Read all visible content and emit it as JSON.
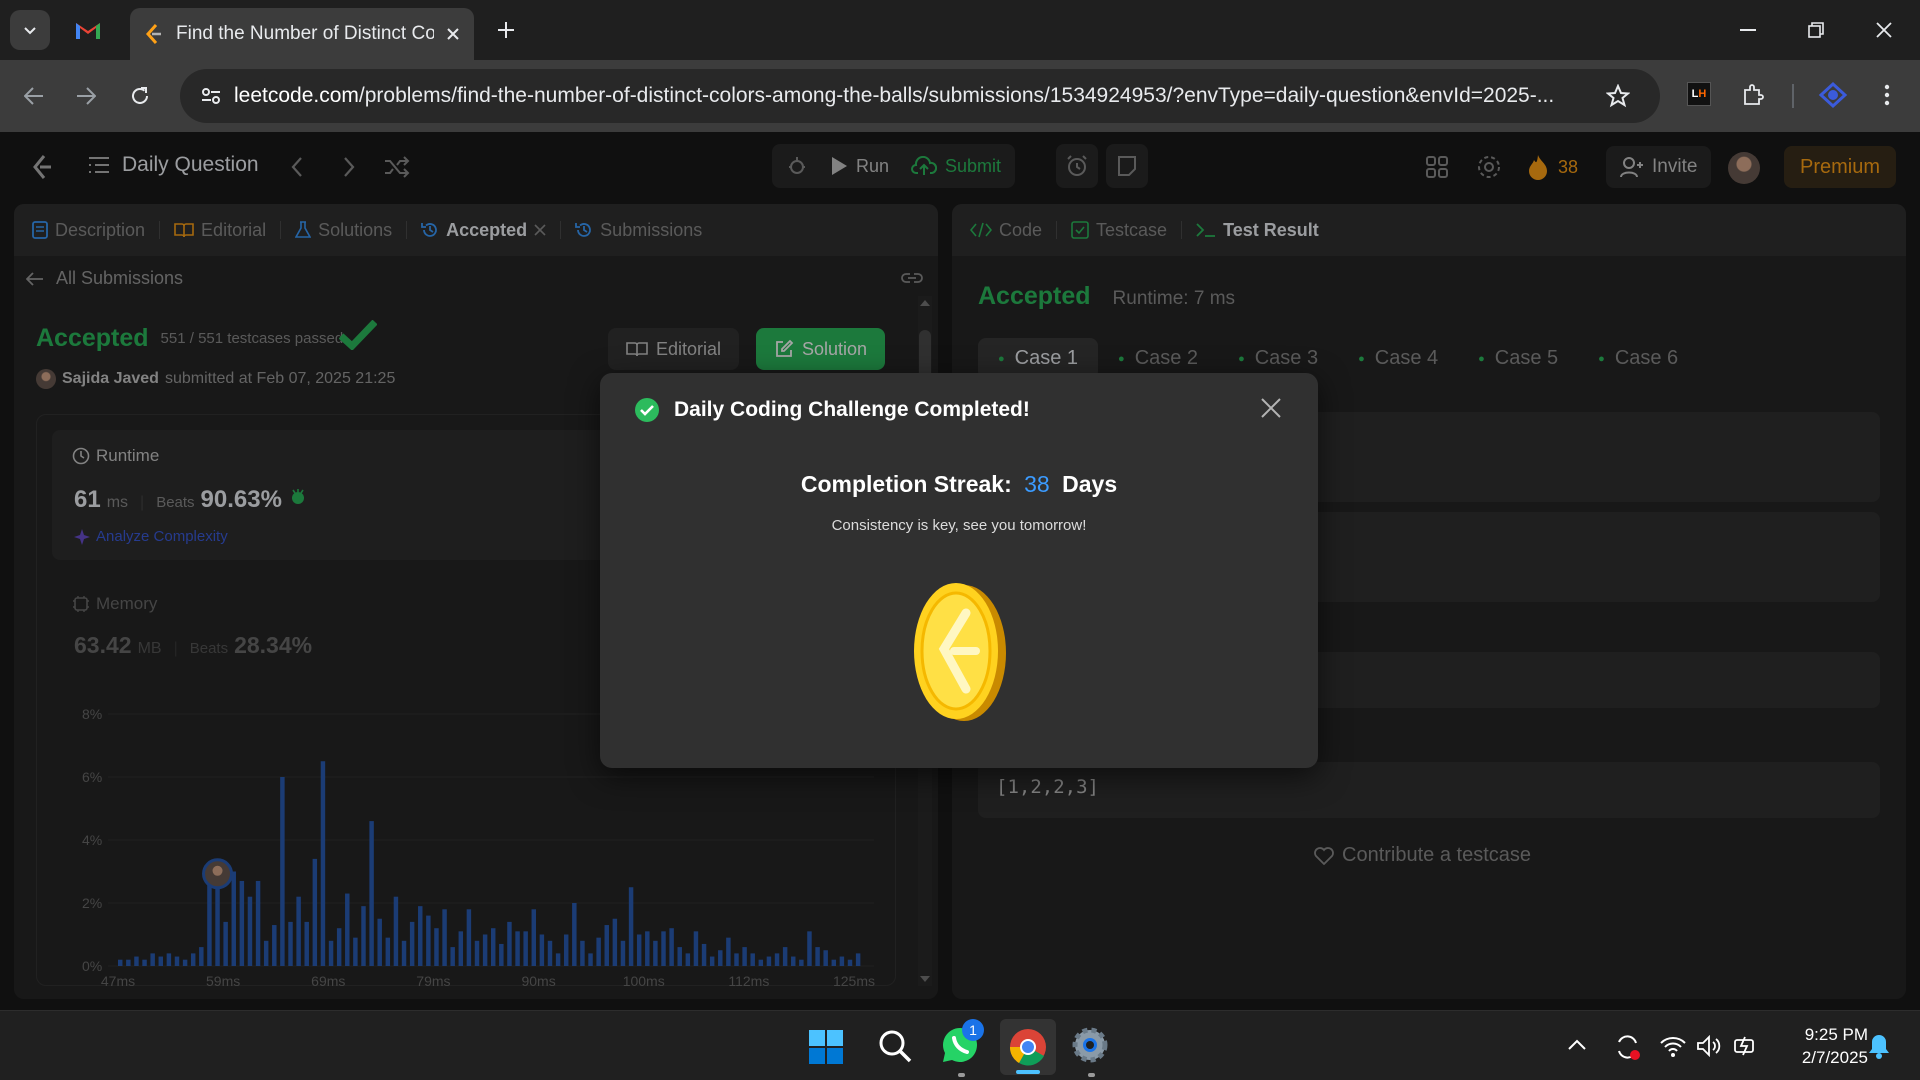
{
  "browser": {
    "tab_title": "Find the Number of Distinct Co",
    "url_host": "leetcode.com",
    "url_path": "/problems/find-the-number-of-distinct-colors-among-the-balls/submissions/1534924953/?envType=daily-question&envId=2025-..."
  },
  "nav": {
    "title": "Daily Question",
    "run_label": "Run",
    "submit_label": "Submit",
    "streak_count": "38",
    "invite_label": "Invite",
    "premium_label": "Premium"
  },
  "left_panel": {
    "tabs": [
      "Description",
      "Editorial",
      "Solutions",
      "Accepted",
      "Submissions"
    ],
    "back_label": "All Submissions",
    "status": "Accepted",
    "testcases": "551 / 551 testcases passed",
    "user": "Sajida Javed",
    "submitted_at": "submitted at Feb 07, 2025 21:25",
    "editorial_btn": "Editorial",
    "solution_btn": "Solution",
    "runtime_label": "Runtime",
    "runtime_value": "61",
    "runtime_unit": "ms",
    "beats_label": "Beats",
    "runtime_beats": "90.63%",
    "analyze_label": "Analyze Complexity",
    "memory_label": "Memory",
    "memory_value": "63.42",
    "memory_unit": "MB",
    "memory_beats": "28.34%"
  },
  "chart_data": {
    "type": "bar",
    "y_ticks": [
      "8%",
      "6%",
      "4%",
      "2%",
      "0%"
    ],
    "x_ticks": [
      "47ms",
      "59ms",
      "69ms",
      "79ms",
      "90ms",
      "100ms",
      "112ms",
      "125ms"
    ],
    "ylim": [
      0,
      8
    ],
    "values": [
      0.2,
      0.2,
      0.3,
      0.2,
      0.4,
      0.3,
      0.4,
      0.3,
      0.2,
      0.4,
      0.6,
      3.1,
      2.8,
      1.4,
      3.0,
      2.7,
      2.2,
      2.7,
      0.8,
      1.3,
      6.0,
      1.4,
      2.2,
      1.4,
      3.4,
      6.5,
      0.8,
      1.2,
      2.3,
      0.9,
      1.9,
      4.6,
      1.5,
      0.9,
      2.2,
      0.8,
      1.4,
      1.9,
      1.6,
      1.2,
      1.8,
      0.6,
      1.1,
      1.8,
      0.8,
      1.0,
      1.2,
      0.7,
      1.4,
      1.1,
      1.1,
      1.8,
      1.0,
      0.8,
      0.4,
      1.0,
      2.0,
      0.8,
      0.4,
      0.9,
      1.3,
      1.5,
      0.8,
      2.5,
      1.0,
      1.1,
      0.8,
      1.1,
      1.2,
      0.6,
      0.4,
      1.1,
      0.7,
      0.3,
      0.5,
      0.9,
      0.4,
      0.6,
      0.4,
      0.2,
      0.3,
      0.4,
      0.6,
      0.3,
      0.2,
      1.1,
      0.6,
      0.5,
      0.2,
      0.3,
      0.2,
      0.4
    ],
    "highlight_index": 12,
    "color": "#2a5cb4"
  },
  "right_panel": {
    "tabs": [
      "Code",
      "Testcase",
      "Test Result"
    ],
    "status": "Accepted",
    "runtime": "Runtime: 7 ms",
    "cases": [
      "Case 1",
      "Case 2",
      "Case 3",
      "Case 4",
      "Case 5",
      "Case 6"
    ],
    "output_value": "[1,2,2,3]",
    "contribute_label": "Contribute a testcase"
  },
  "modal": {
    "title": "Daily Coding Challenge Completed!",
    "streak_label": "Completion Streak:",
    "streak_days": "38",
    "days_label": "Days",
    "subtitle": "Consistency is key, see you tomorrow!"
  },
  "taskbar": {
    "time": "9:25 PM",
    "date": "2/7/2025",
    "whatsapp_badge": "1"
  },
  "colors": {
    "accepted": "#2cbb5d",
    "accent_blue": "#3b9bff",
    "premium": "#ffa116"
  }
}
